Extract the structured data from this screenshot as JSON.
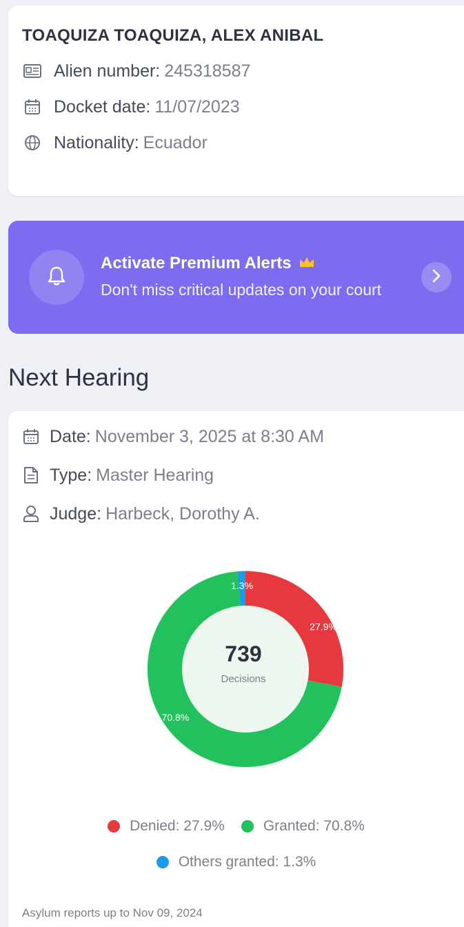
{
  "case": {
    "name": "TOAQUIZA TOAQUIZA, ALEX ANIBAL",
    "alien_label": "Alien number:",
    "alien_value": "245318587",
    "docket_label": "Docket date:",
    "docket_value": "11/07/2023",
    "nationality_label": "Nationality:",
    "nationality_value": "Ecuador"
  },
  "premium": {
    "title": "Activate Premium Alerts",
    "subtitle": "Don't miss critical updates on your court",
    "color": "#7b6cf0"
  },
  "next_hearing": {
    "section_title": "Next Hearing",
    "date_label": "Date:",
    "date_value": "November 3, 2025 at 8:30 AM",
    "type_label": "Type:",
    "type_value": "Master Hearing",
    "judge_label": "Judge:",
    "judge_value": "Harbeck, Dorothy A."
  },
  "chart_data": {
    "type": "pie",
    "center_value": "739",
    "center_label": "Decisions",
    "slices": [
      {
        "name": "Denied",
        "value": 27.9,
        "label": "27.9%",
        "color": "#e5393f"
      },
      {
        "name": "Granted",
        "value": 70.8,
        "label": "70.8%",
        "color": "#22c15e"
      },
      {
        "name": "Others granted",
        "value": 1.3,
        "label": "1.3%",
        "color": "#1d9be8"
      }
    ]
  },
  "legend": {
    "denied": "Denied: 27.9%",
    "granted": "Granted: 70.8%",
    "others": "Others granted: 1.3%"
  },
  "footnote": "Asylum reports up to Nov 09, 2024",
  "icons": [
    "id-card-icon",
    "calendar-icon",
    "globe-icon",
    "bell-icon",
    "crown-icon",
    "chevron-right-icon",
    "document-icon",
    "user-icon"
  ]
}
